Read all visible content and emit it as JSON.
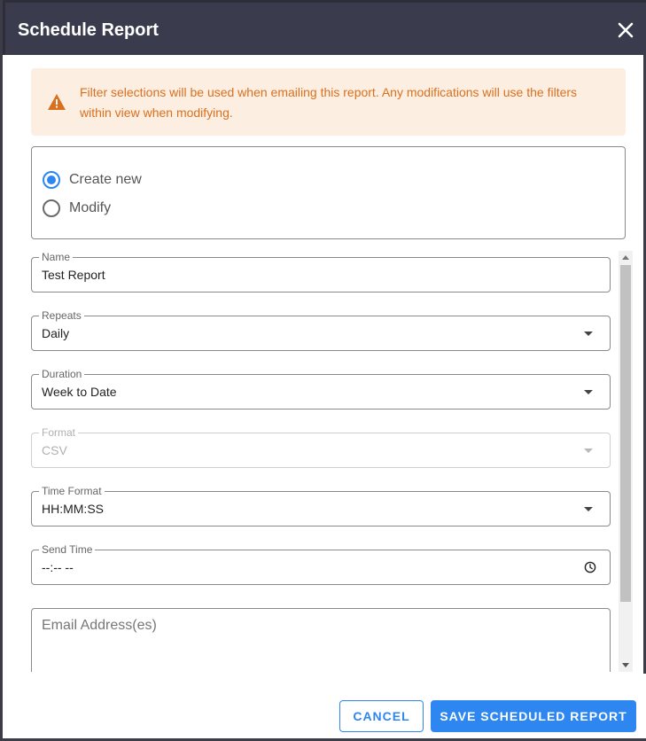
{
  "dialog": {
    "title": "Schedule Report",
    "close_icon": "close-icon"
  },
  "alert": {
    "icon": "warning-icon",
    "text": "Filter selections will be used when emailing this report. Any modifications will use the filters within view when modifying.",
    "color": "#d9701f",
    "background": "#fdeee2"
  },
  "mode": {
    "options": [
      {
        "label": "Create new",
        "checked": true
      },
      {
        "label": "Modify",
        "checked": false
      }
    ]
  },
  "form": {
    "name": {
      "label": "Name",
      "value": "Test Report"
    },
    "repeats": {
      "label": "Repeats",
      "value": "Daily"
    },
    "duration": {
      "label": "Duration",
      "value": "Week to Date"
    },
    "format": {
      "label": "Format",
      "value": "CSV",
      "disabled": true
    },
    "time_format": {
      "label": "Time Format",
      "value": "HH:MM:SS"
    },
    "send_time": {
      "label": "Send Time",
      "value": "--:-- --",
      "icon": "clock-icon"
    },
    "emails": {
      "placeholder": "Email Address(es)"
    }
  },
  "footer": {
    "cancel_label": "CANCEL",
    "save_label": "SAVE SCHEDULED REPORT"
  },
  "colors": {
    "accent": "#2e86f0",
    "titlebar": "#3a3c4e"
  }
}
